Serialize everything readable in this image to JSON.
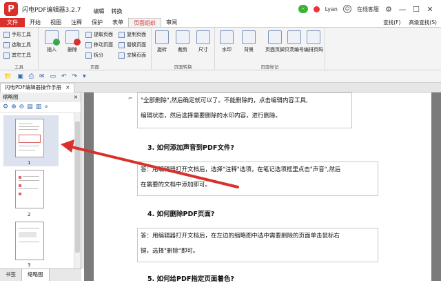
{
  "app": {
    "logo": "P",
    "title": "闪电PDF编辑器3.2.7",
    "menu": [
      "编辑",
      "转换"
    ]
  },
  "user": {
    "name": "Lyan",
    "service": "在线客服"
  },
  "ribbon_tabs": [
    "文件",
    "开始",
    "视图",
    "注释",
    "保护",
    "表单",
    "页面组织",
    "审阅"
  ],
  "find": {
    "find": "查找(F)",
    "advanced": "高级查找(S)"
  },
  "tools_group": {
    "label": "工具",
    "hand": "手形工具",
    "select": "选取工具",
    "other": "其它工具"
  },
  "page_group": {
    "label": "页面",
    "insert": "插入",
    "delete": "删除",
    "extract": "提取页面",
    "move": "移动页面",
    "split": "拆分",
    "copy": "复制页面",
    "replace": "替换页面",
    "swap": "交换页面"
  },
  "transform_group": {
    "label": "页面转换",
    "rotate": "旋转",
    "crop": "裁剪",
    "size": "尺寸"
  },
  "mark_group": {
    "label": "页面标记",
    "watermark": "水印",
    "background": "背景",
    "header": "页面页脚",
    "bates": "贝茨编号",
    "number": "编排页码"
  },
  "doc_tab": {
    "title": "闪电PDF编辑器操作手册",
    "close": "×"
  },
  "panel": {
    "title": "缩略图",
    "close": "×",
    "thumbs": [
      {
        "num": "1"
      },
      {
        "num": "2"
      },
      {
        "num": "3"
      }
    ]
  },
  "bottom_tabs": [
    "书签",
    "缩略图"
  ],
  "document": {
    "para1_line1": "\"全部删除\",然后确定就可以了。不能删除的，点击编辑内容工具,",
    "para1_line2": "编辑状态，然后选择需要删除的水印内容，进行删除。",
    "heading3": "3. 如何添加声音到PDF文件?",
    "para2_line1": "答：用编辑器打开文档后，选择\"注释\"选项，在笔记选项框里点击\"声音\",然后",
    "para2_line2": "在需要的文档中添加即可。",
    "heading4": "4. 如何删除PDF页面?",
    "para3_line1": "答：用编辑器打开文档后，在左边的缩略图中选中需要删除的页面单击鼠标右",
    "para3_line2": "键，选择\"删除\"即可。",
    "heading5": "5. 如何给PDF指定页面着色?"
  },
  "colors": {
    "accent_red": "#d9302c",
    "ribbon_bg": "#f4f4f4",
    "doc_bg": "#7b7b7b"
  }
}
